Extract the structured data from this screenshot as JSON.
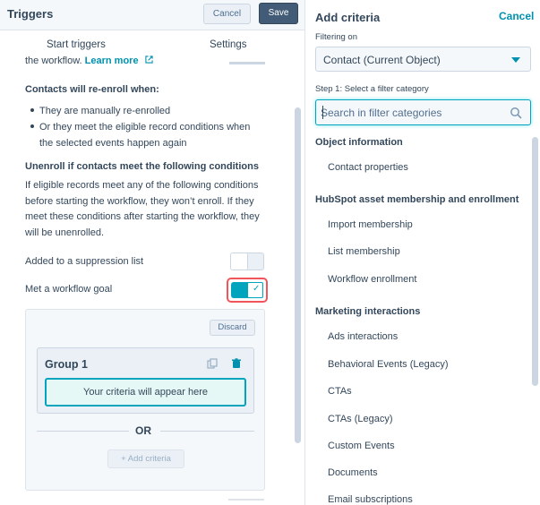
{
  "left_panel": {
    "title": "Triggers",
    "cancel_label": "Cancel",
    "save_label": "Save",
    "tabs": [
      "Start triggers",
      "Settings"
    ],
    "cut_text": "the workflow.",
    "cut_link": "Learn more",
    "reenroll": {
      "heading": "Contacts will re-enroll when:",
      "bullets": [
        "They are manually re-enrolled",
        "Or they meet the eligible record conditions when",
        "the selected events happen again"
      ]
    },
    "unenroll": {
      "heading": "Unenroll if contacts meet the following conditions",
      "paragraph": "If eligible records meet any of the following conditions before starting the workflow, they won’t enroll. If they meet these conditions after starting the workflow, they will be unenrolled."
    },
    "suppression_label": "Added to a suppression list",
    "goal_label": "Met a workflow goal",
    "goal_box": {
      "discard_label": "Discard",
      "group_title": "Group 1",
      "criteria_placeholder": "Your criteria will appear here",
      "or_label": "OR",
      "add_criteria_label": "+ Add criteria"
    }
  },
  "right_panel": {
    "title": "Add criteria",
    "cancel_label": "Cancel",
    "filtering_on_label": "Filtering on",
    "filtering_on_value": "Contact (Current Object)",
    "step_label": "Step 1: Select a filter category",
    "search_placeholder": "Search in filter categories",
    "categories": {
      "object_information": {
        "heading": "Object information",
        "items": [
          "Contact properties"
        ]
      },
      "hubspot_assets": {
        "heading": "HubSpot asset membership and enrollment",
        "items": [
          "Import membership",
          "List membership",
          "Workflow enrollment"
        ]
      },
      "marketing_interactions": {
        "heading": "Marketing interactions",
        "items": [
          "Ads interactions",
          "Behavioral Events (Legacy)",
          "CTAs",
          "CTAs (Legacy)",
          "Custom Events",
          "Documents",
          "Email subscriptions"
        ]
      }
    }
  },
  "colors": {
    "accent": "#00a4bd",
    "link": "#0091ae",
    "text": "#33475b",
    "save_button": "#425b76",
    "highlight": "#f2545b"
  }
}
